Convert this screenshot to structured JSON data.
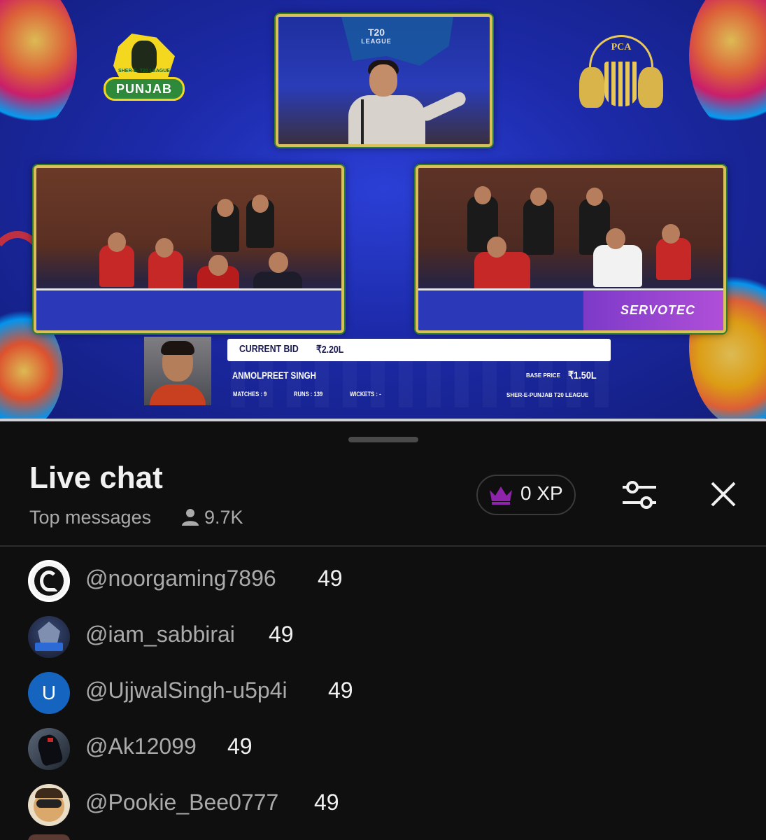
{
  "video": {
    "league_logo_text": "PUNJAB",
    "league_logo_sub": "SHER-E- T20 LEAGUE",
    "pca_logo_text": "PCA",
    "t20_banner": "T20",
    "t20_banner_sub": "LEAGUE",
    "sponsor": "SERVOTEC",
    "bid_label": "CURRENT BID",
    "bid_value": "₹2.20L",
    "player_name": "ANMOLPREET SINGH",
    "matches": "MATCHES : 9",
    "runs": "RUNS : 139",
    "wickets": "WICKETS : -",
    "base_price_label": "BASE PRICE",
    "base_price_value": "₹1.50L",
    "league_name": "SHER-E-PUNJAB T20 LEAGUE"
  },
  "chat": {
    "title": "Live chat",
    "subtitle": "Top messages",
    "viewer_count": "9.7K",
    "xp": "0 XP",
    "colors": {
      "background": "#0f0f0f",
      "xp_crown": "#8e24aa",
      "avatar_u": "#1565c0"
    },
    "icons": {
      "viewers": "person-icon",
      "xp": "crown-icon",
      "filter": "settings-sliders-icon",
      "close": "close-icon"
    },
    "messages": [
      {
        "handle": "@noorgaming7896",
        "count": "49",
        "avatar": "snake-logo"
      },
      {
        "handle": "@iam_sabbirai",
        "count": "49",
        "avatar": "gaming-badge"
      },
      {
        "handle": "@UjjwalSingh-u5p4i",
        "count": "49",
        "avatar_letter": "U"
      },
      {
        "handle": "@Ak12099",
        "count": "49",
        "avatar": "dark-figure"
      },
      {
        "handle": "@Pookie_Bee0777",
        "count": "49",
        "avatar": "face-glasses"
      }
    ]
  }
}
